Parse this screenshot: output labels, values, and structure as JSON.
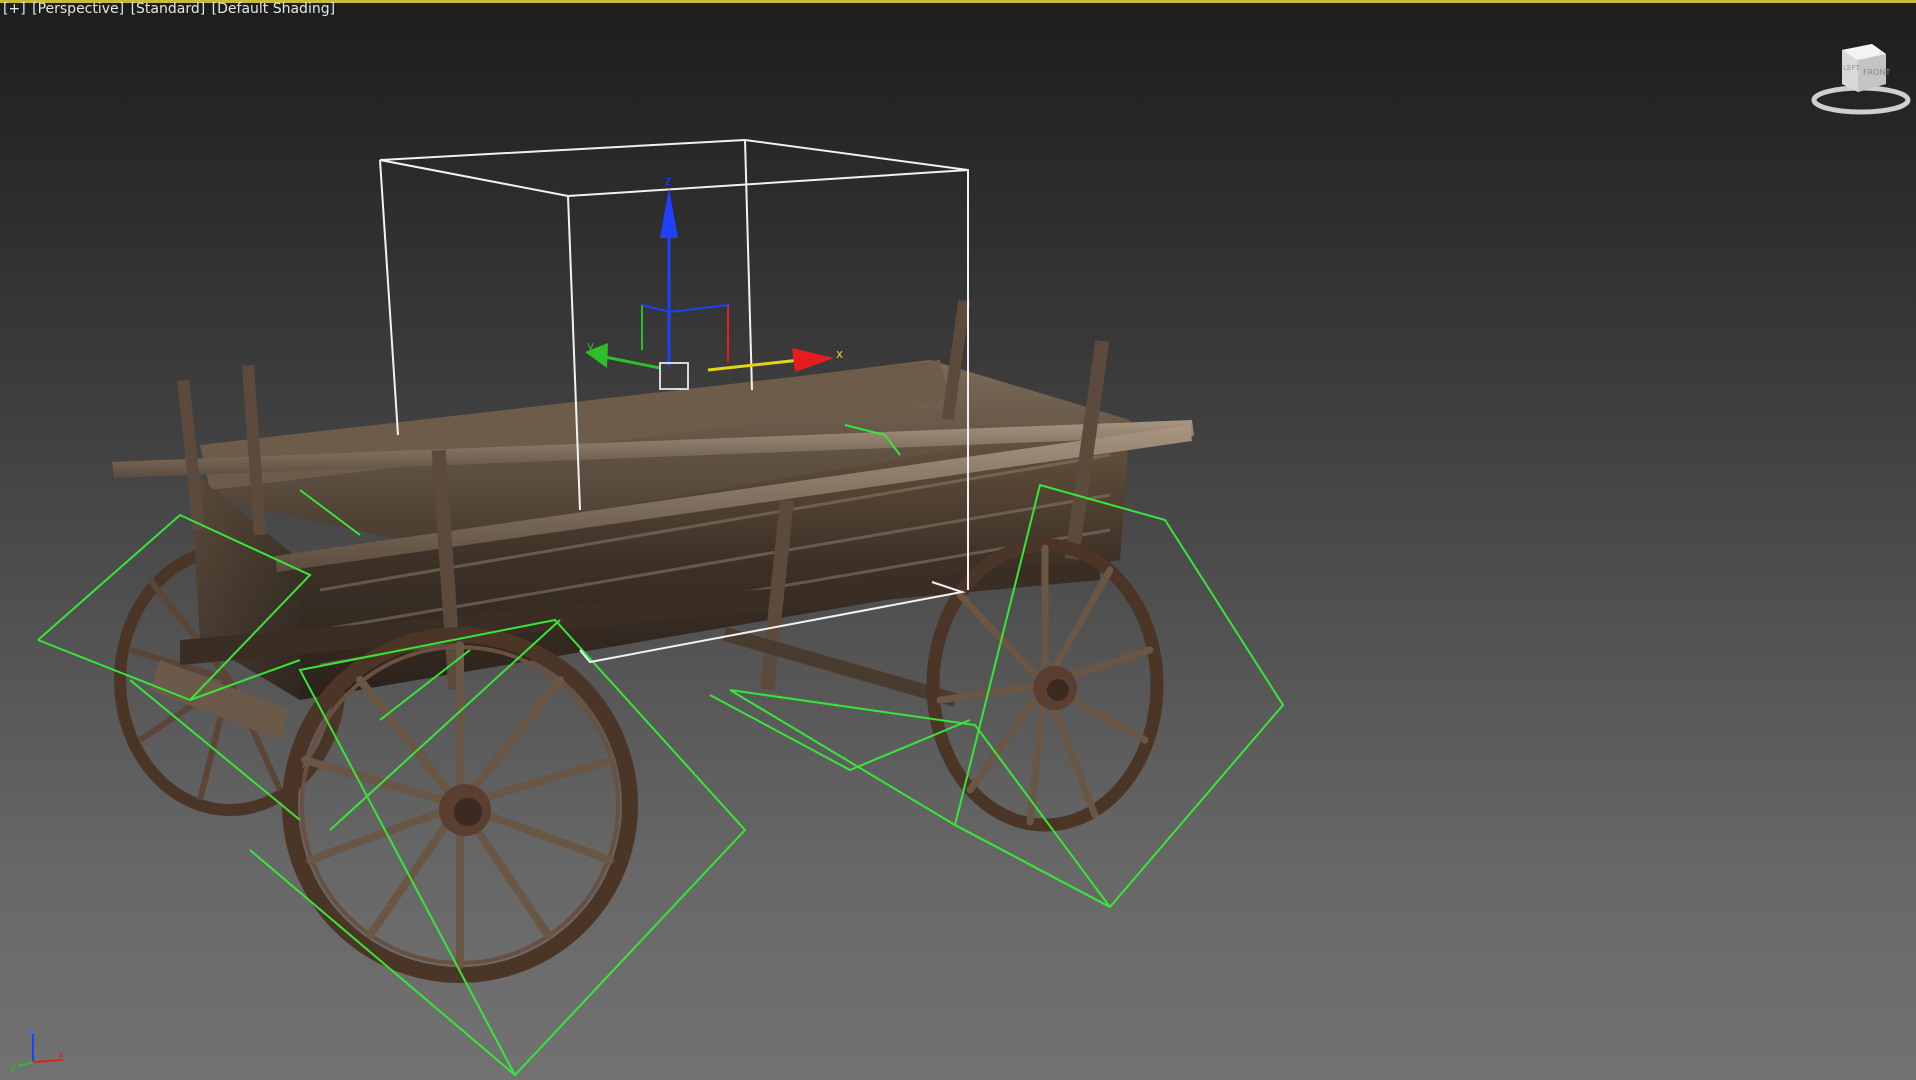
{
  "viewport": {
    "labels": {
      "menu": "[+]",
      "view": "[Perspective]",
      "shading_style": "[Standard]",
      "shading": "[Default Shading]"
    },
    "active_border_color": "#c8bd38"
  },
  "gizmo": {
    "x_label": "x",
    "y_label": "y",
    "z_label": "z",
    "x_color": "#e41e1e",
    "y_color": "#2bbf2b",
    "z_color": "#1e40ff",
    "plane_color": "#e6d21c"
  },
  "viewcube": {
    "face_label": "FRONT",
    "side_label": "LEFT"
  },
  "world_axis": {
    "x_label": "x",
    "y_label": "y",
    "z_label": "z"
  },
  "scene": {
    "selection_bracket_color": "#ffffff",
    "helper_color": "#37e637",
    "object": "wooden wagon"
  }
}
